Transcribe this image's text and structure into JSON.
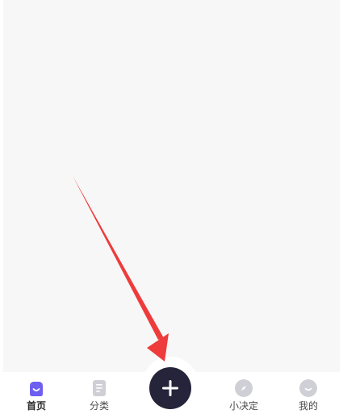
{
  "tabbar": {
    "home_label": "首页",
    "category_label": "分类",
    "decide_label": "小决定",
    "mine_label": "我的"
  },
  "icons": {
    "home": "smile-bag-icon",
    "category": "document-icon",
    "add": "plus-icon",
    "decide": "compass-icon",
    "mine": "smile-face-icon"
  },
  "colors": {
    "accent": "#6e5ff0",
    "inactive_icon": "#cfcfd6",
    "add_button": "#25243a",
    "annotation_arrow": "#ee3b3b"
  }
}
